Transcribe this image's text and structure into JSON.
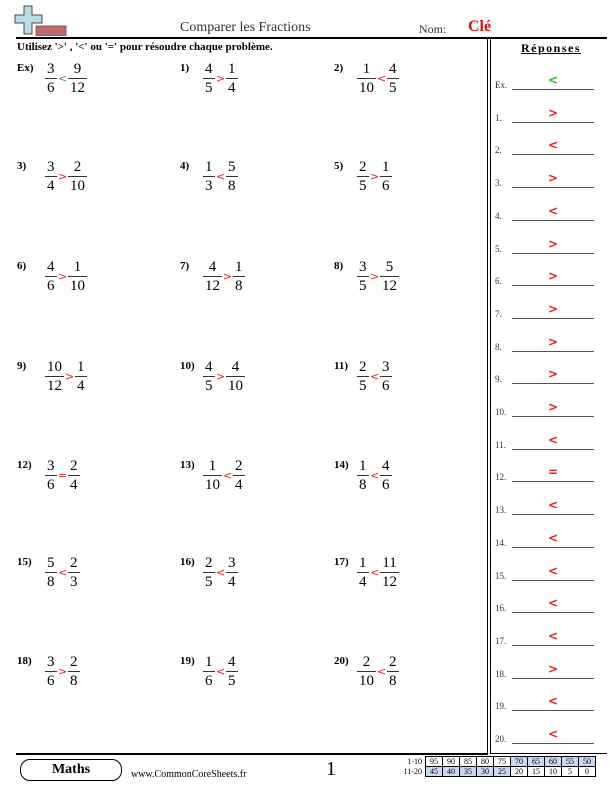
{
  "header": {
    "logo": "math-cross-logo-icon",
    "title": "Comparer les Fractions",
    "nom_label": "Nom:",
    "nom_value": "Clé",
    "instructions": "Utilisez '>' , '<' ou '=' pour résoudre chaque problème."
  },
  "colors": {
    "example_symbol": "#22bb22",
    "answer_symbol": "#e02020",
    "key_label": "#e01010",
    "score_highlight": "#c9d9f5"
  },
  "problems": [
    {
      "label": "Ex)",
      "left": {
        "n": "3",
        "d": "6"
      },
      "symbol": "<",
      "right": {
        "n": "9",
        "d": "12"
      },
      "example": true
    },
    {
      "label": "1)",
      "left": {
        "n": "4",
        "d": "5"
      },
      "symbol": ">",
      "right": {
        "n": "1",
        "d": "4"
      }
    },
    {
      "label": "2)",
      "left": {
        "n": "1",
        "d": "10"
      },
      "symbol": "<",
      "right": {
        "n": "4",
        "d": "5"
      }
    },
    {
      "label": "3)",
      "left": {
        "n": "3",
        "d": "4"
      },
      "symbol": ">",
      "right": {
        "n": "2",
        "d": "10"
      }
    },
    {
      "label": "4)",
      "left": {
        "n": "1",
        "d": "3"
      },
      "symbol": "<",
      "right": {
        "n": "5",
        "d": "8"
      }
    },
    {
      "label": "5)",
      "left": {
        "n": "2",
        "d": "5"
      },
      "symbol": ">",
      "right": {
        "n": "1",
        "d": "6"
      }
    },
    {
      "label": "6)",
      "left": {
        "n": "4",
        "d": "6"
      },
      "symbol": ">",
      "right": {
        "n": "1",
        "d": "10"
      }
    },
    {
      "label": "7)",
      "left": {
        "n": "4",
        "d": "12"
      },
      "symbol": ">",
      "right": {
        "n": "1",
        "d": "8"
      }
    },
    {
      "label": "8)",
      "left": {
        "n": "3",
        "d": "5"
      },
      "symbol": ">",
      "right": {
        "n": "5",
        "d": "12"
      }
    },
    {
      "label": "9)",
      "left": {
        "n": "10",
        "d": "12"
      },
      "symbol": ">",
      "right": {
        "n": "1",
        "d": "4"
      }
    },
    {
      "label": "10)",
      "left": {
        "n": "4",
        "d": "5"
      },
      "symbol": ">",
      "right": {
        "n": "4",
        "d": "10"
      }
    },
    {
      "label": "11)",
      "left": {
        "n": "2",
        "d": "5"
      },
      "symbol": "<",
      "right": {
        "n": "3",
        "d": "6"
      }
    },
    {
      "label": "12)",
      "left": {
        "n": "3",
        "d": "6"
      },
      "symbol": "=",
      "right": {
        "n": "2",
        "d": "4"
      }
    },
    {
      "label": "13)",
      "left": {
        "n": "1",
        "d": "10"
      },
      "symbol": "<",
      "right": {
        "n": "2",
        "d": "4"
      }
    },
    {
      "label": "14)",
      "left": {
        "n": "1",
        "d": "8"
      },
      "symbol": "<",
      "right": {
        "n": "4",
        "d": "6"
      }
    },
    {
      "label": "15)",
      "left": {
        "n": "5",
        "d": "8"
      },
      "symbol": "<",
      "right": {
        "n": "2",
        "d": "3"
      }
    },
    {
      "label": "16)",
      "left": {
        "n": "2",
        "d": "5"
      },
      "symbol": "<",
      "right": {
        "n": "3",
        "d": "4"
      }
    },
    {
      "label": "17)",
      "left": {
        "n": "1",
        "d": "4"
      },
      "symbol": "<",
      "right": {
        "n": "11",
        "d": "12"
      }
    },
    {
      "label": "18)",
      "left": {
        "n": "3",
        "d": "6"
      },
      "symbol": ">",
      "right": {
        "n": "2",
        "d": "8"
      }
    },
    {
      "label": "19)",
      "left": {
        "n": "1",
        "d": "6"
      },
      "symbol": "<",
      "right": {
        "n": "4",
        "d": "5"
      }
    },
    {
      "label": "20)",
      "left": {
        "n": "2",
        "d": "10"
      },
      "symbol": "<",
      "right": {
        "n": "2",
        "d": "8"
      }
    }
  ],
  "answers": {
    "title": "Réponses",
    "items": [
      {
        "label": "Ex.",
        "value": "<",
        "example": true
      },
      {
        "label": "1.",
        "value": ">"
      },
      {
        "label": "2.",
        "value": "<"
      },
      {
        "label": "3.",
        "value": ">"
      },
      {
        "label": "4.",
        "value": "<"
      },
      {
        "label": "5.",
        "value": ">"
      },
      {
        "label": "6.",
        "value": ">"
      },
      {
        "label": "7.",
        "value": ">"
      },
      {
        "label": "8.",
        "value": ">"
      },
      {
        "label": "9.",
        "value": ">"
      },
      {
        "label": "10.",
        "value": ">"
      },
      {
        "label": "11.",
        "value": "<"
      },
      {
        "label": "12.",
        "value": "="
      },
      {
        "label": "13.",
        "value": "<"
      },
      {
        "label": "14.",
        "value": "<"
      },
      {
        "label": "15.",
        "value": "<"
      },
      {
        "label": "16.",
        "value": "<"
      },
      {
        "label": "17.",
        "value": "<"
      },
      {
        "label": "18.",
        "value": ">"
      },
      {
        "label": "19.",
        "value": "<"
      },
      {
        "label": "20.",
        "value": "<"
      }
    ]
  },
  "footer": {
    "badge": "Maths",
    "site": "www.CommonCoreSheets.fr",
    "page": "1",
    "score_table": [
      {
        "range": "1-10",
        "scores": [
          "95",
          "90",
          "85",
          "80",
          "75",
          "70",
          "65",
          "60",
          "55",
          "50"
        ],
        "highlight": [
          false,
          false,
          false,
          false,
          false,
          true,
          true,
          true,
          true,
          true
        ]
      },
      {
        "range": "11-20",
        "scores": [
          "45",
          "40",
          "35",
          "30",
          "25",
          "20",
          "15",
          "10",
          "5",
          "0"
        ],
        "highlight": [
          true,
          true,
          true,
          true,
          true,
          false,
          false,
          false,
          false,
          false
        ]
      }
    ]
  }
}
